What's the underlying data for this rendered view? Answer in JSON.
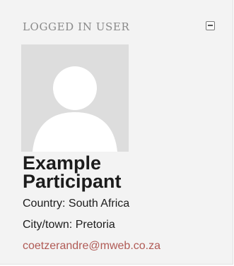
{
  "block": {
    "title": "LOGGED IN USER",
    "collapse_icon": "minus-square-icon"
  },
  "user": {
    "avatar_icon": "default-user-avatar-icon",
    "name_line1": "Example",
    "name_line2": "Participant",
    "country": "Country: South Africa",
    "city": "City/town: Pretoria",
    "email": "coetzerandre@mweb.co.za"
  },
  "colors": {
    "panel_bg": "#f3f3f3",
    "title": "#8a8a8a",
    "text": "#1c1c1c",
    "link": "#b05a55",
    "avatar_bg": "#dddddd"
  }
}
